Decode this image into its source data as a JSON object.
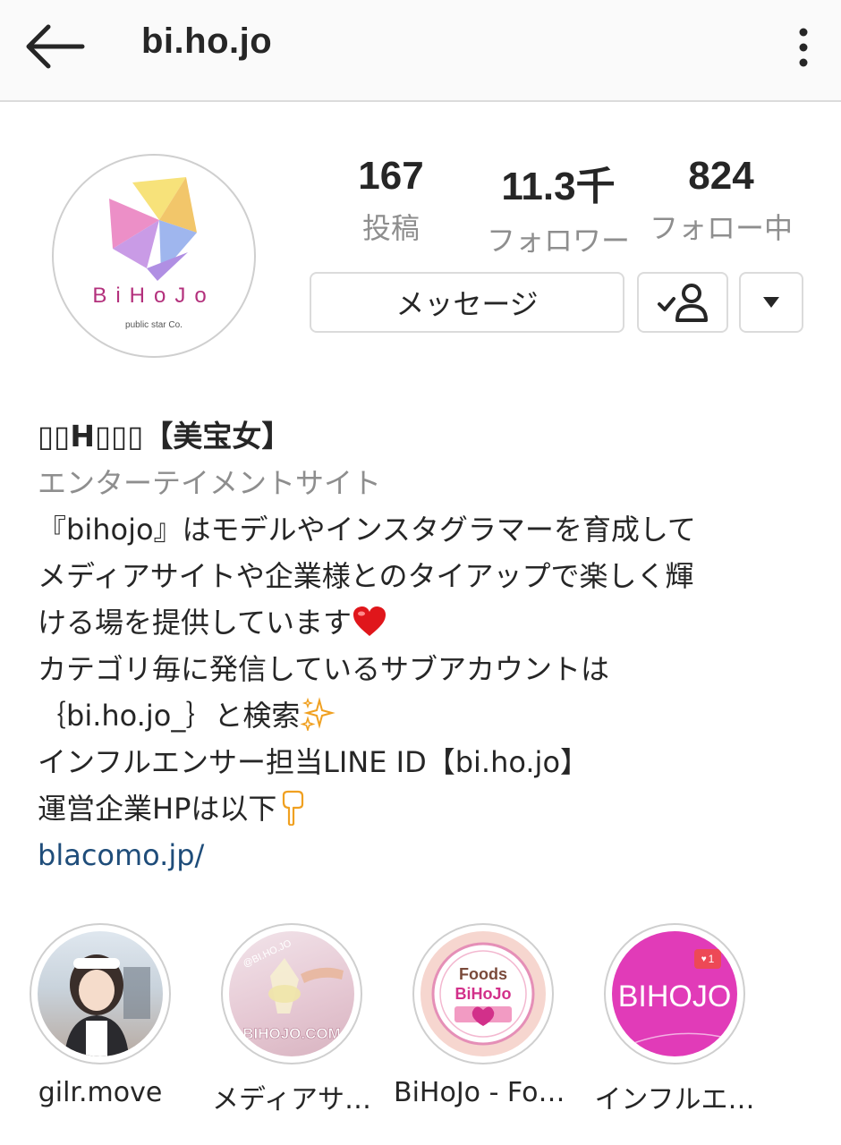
{
  "header": {
    "title": "bi.ho.jo"
  },
  "profile": {
    "avatar_text": "BiHoJo",
    "avatar_sub": "public star Co.",
    "stats": [
      {
        "value": "167",
        "label": "投稿"
      },
      {
        "value": "11.3千",
        "label": "フォロワー"
      },
      {
        "value": "824",
        "label": "フォロー中"
      }
    ]
  },
  "actions": {
    "message_label": "メッセージ"
  },
  "bio": {
    "name": "▯▯H▯▯▯【美宝女】",
    "category": "エンターテイメントサイト",
    "lines": [
      "『bihojo』はモデルやインスタグラマーを育成して",
      "メディアサイトや企業様とのタイアップで楽しく輝",
      "ける場を提供しています",
      "カテゴリ毎に発信しているサブアカウントは",
      "｛bi.ho.jo_｝と検索",
      "インフルエンサー担当LINE ID【bi.ho.jo】",
      "運営企業HPは以下"
    ],
    "link": "blacomo.jp/"
  },
  "highlights": [
    {
      "label": "gilr.move"
    },
    {
      "label": "メディアサ…",
      "image_text": "BIHOJO.COM",
      "image_tag": "@BI.HO.JO"
    },
    {
      "label": "BiHoJo - Foo…",
      "image_text_1": "Foods",
      "image_text_2": "BiHoJo"
    },
    {
      "label": "インフルエ…",
      "image_text": "BIHOJO",
      "badge": "1"
    }
  ],
  "colors": {
    "link": "#1f4d7a",
    "secondary": "#8e8e8e",
    "highlight_pink": "#e13bb8"
  }
}
